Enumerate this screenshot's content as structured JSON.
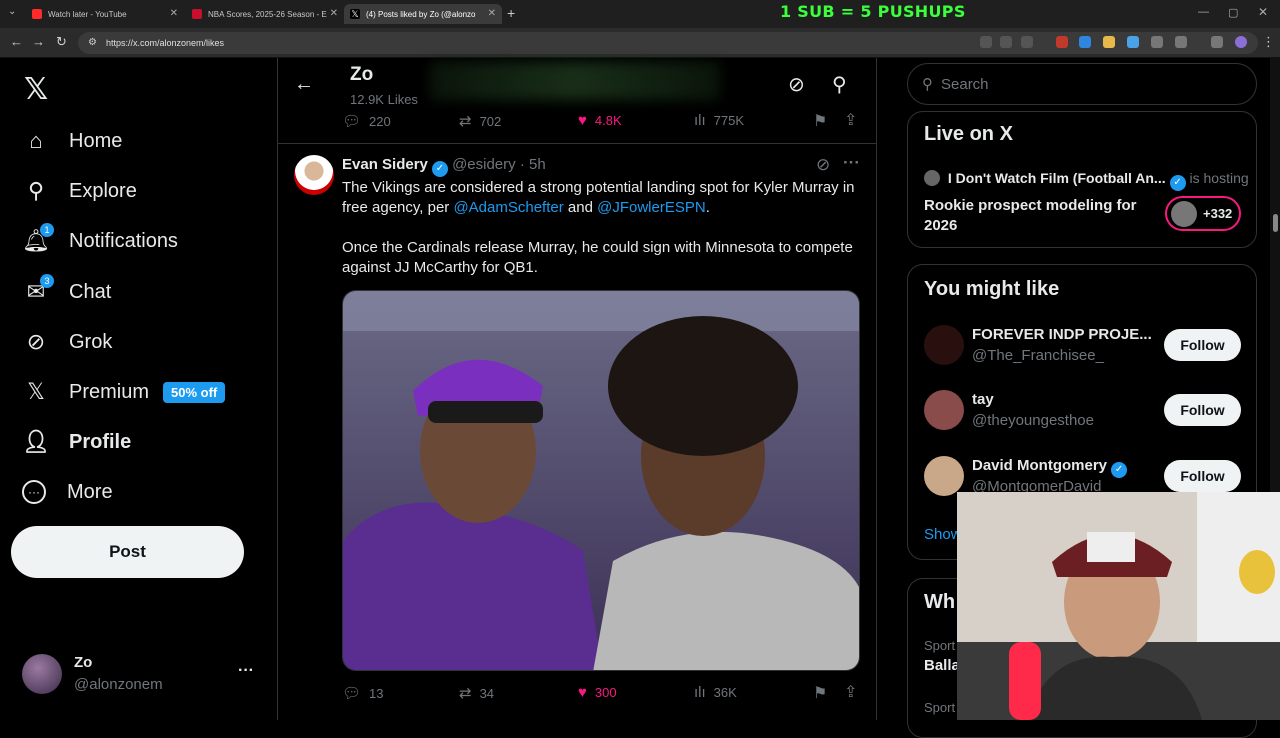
{
  "browser": {
    "tabs": [
      {
        "title": "Watch later - YouTube"
      },
      {
        "title": "NBA Scores, 2025-26 Season - E"
      },
      {
        "title": "(4) Posts liked by Zo (@alonzo"
      }
    ],
    "url": "https://x.com/alonzonem/likes",
    "overlay": "1 SUB = 5 PUSHUPS"
  },
  "nav": {
    "items": [
      {
        "label": "Home"
      },
      {
        "label": "Explore"
      },
      {
        "label": "Notifications",
        "badge": "1"
      },
      {
        "label": "Chat",
        "badge": "3"
      },
      {
        "label": "Grok"
      },
      {
        "label": "Premium",
        "pill": "50% off"
      },
      {
        "label": "Profile"
      },
      {
        "label": "More"
      }
    ],
    "post_label": "Post",
    "account": {
      "name": "Zo",
      "handle": "@alonzonem",
      "more": "···"
    }
  },
  "header": {
    "name": "Zo",
    "subtitle": "12.9K Likes"
  },
  "prev_tweet_actions": {
    "replies": "220",
    "reposts": "702",
    "likes": "4.8K",
    "views": "775K"
  },
  "tweet": {
    "author": "Evan Sidery",
    "handle": "@esidery",
    "time": "· 5h",
    "text1": "The Vikings are considered a strong potential landing spot for Kyler Murray in free agency, per ",
    "mention1": "@AdamSchefter",
    "and": " and ",
    "mention2": "@JFowlerESPN",
    "period": ".",
    "text2": "Once the Cardinals release Murray, he could sign with Minnesota to compete against JJ McCarthy for QB1.",
    "actions": {
      "replies": "13",
      "reposts": "34",
      "likes": "300",
      "views": "36K"
    }
  },
  "right": {
    "search_placeholder": "Search",
    "live": {
      "title": "Live on X",
      "host": "I Don't Watch Film (Football An...",
      "hosting": "is hosting",
      "topic": "Rookie prospect modeling for 2026",
      "count": "+332"
    },
    "suggest": {
      "title": "You might like",
      "users": [
        {
          "name": "FOREVER INDP PROJE...",
          "handle": "@The_Franchisee_",
          "follow": "Follow"
        },
        {
          "name": "tay",
          "handle": "@theyoungesthoe",
          "follow": "Follow"
        },
        {
          "name": "David Montgomery",
          "handle": "@MontgomerDavid",
          "follow": "Follow"
        }
      ],
      "show_more": "Show"
    },
    "whats": {
      "title": "Wh",
      "cat1": "Sport",
      "item1": "Balla",
      "cat2": "Sport"
    }
  }
}
